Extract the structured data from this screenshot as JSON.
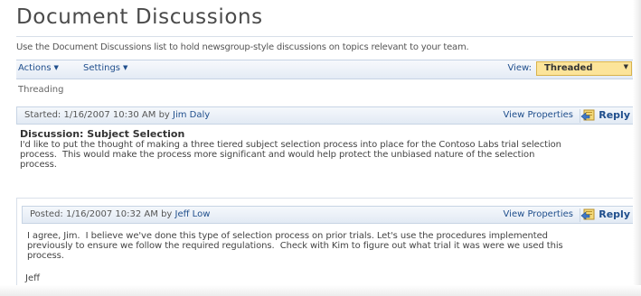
{
  "page": {
    "title": "Document Discussions",
    "description": "Use the Document Discussions list to hold newsgroup-style discussions on topics relevant to your team."
  },
  "toolbar": {
    "actions_label": "Actions",
    "settings_label": "Settings",
    "view_label": "View:",
    "view_value": "Threaded"
  },
  "breadcrumb": "Threading",
  "posts": [
    {
      "meta_prefix": "Started: 1/16/2007 10:30 AM by ",
      "author": "Jim Daly",
      "view_properties": "View Properties",
      "reply": "Reply",
      "subject": "Discussion: Subject Selection",
      "body": "I'd like to put the thought of making a three tiered subject selection process into place for the Contoso Labs trial selection\nprocess.  This would make the process more significant and would help protect the unbiased nature of the selection\nprocess."
    },
    {
      "meta_prefix": "Posted: 1/16/2007 10:32 AM by ",
      "author": "Jeff Low",
      "view_properties": "View Properties",
      "reply": "Reply",
      "body": "I agree, Jim.  I believe we've done this type of selection process on prior trials. Let's use the procedures implemented\npreviously to ensure we follow the required regulations.  Check with Kim to figure out what trial it was were we used this\nprocess.",
      "signature": "Jeff"
    }
  ],
  "colors": {
    "link": "#1f4e8c",
    "header_bg": "#e2eaf4",
    "view_select_bg": "#fce49a"
  },
  "icons": {
    "reply": "reply-icon",
    "dropdown": "chevron-down-icon"
  }
}
